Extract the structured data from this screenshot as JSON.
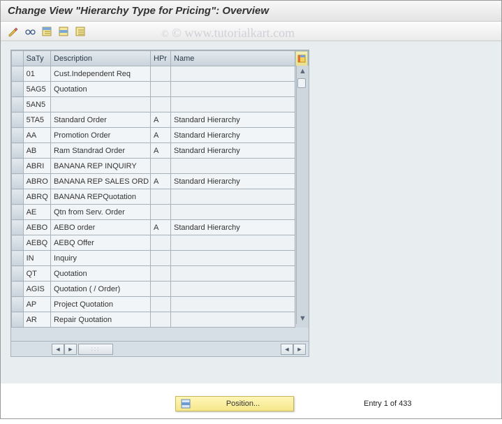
{
  "title": "Change View \"Hierarchy Type for Pricing\": Overview",
  "watermark": "© www.tutorialkart.com",
  "toolbar": {
    "icons": [
      "pencil-icon",
      "glasses-icon",
      "select-all-icon",
      "select-block-icon",
      "deselect-icon"
    ]
  },
  "table": {
    "headers": {
      "saty": "SaTy",
      "description": "Description",
      "hpr": "HPr",
      "name": "Name"
    },
    "rows": [
      {
        "saty": "01",
        "description": "Cust.Independent Req",
        "hpr": "",
        "name": ""
      },
      {
        "saty": "5AG5",
        "description": "Quotation",
        "hpr": "",
        "name": ""
      },
      {
        "saty": "5AN5",
        "description": "",
        "hpr": "",
        "name": ""
      },
      {
        "saty": "5TA5",
        "description": "Standard Order",
        "hpr": "A",
        "name": "Standard Hierarchy"
      },
      {
        "saty": "AA",
        "description": "Promotion Order",
        "hpr": "A",
        "name": "Standard Hierarchy"
      },
      {
        "saty": "AB",
        "description": "Ram Standrad Order",
        "hpr": "A",
        "name": "Standard Hierarchy"
      },
      {
        "saty": "ABRI",
        "description": "BANANA REP INQUIRY",
        "hpr": "",
        "name": ""
      },
      {
        "saty": "ABRO",
        "description": "BANANA REP SALES ORD",
        "hpr": "A",
        "name": "Standard Hierarchy"
      },
      {
        "saty": "ABRQ",
        "description": "BANANA REPQuotation",
        "hpr": "",
        "name": ""
      },
      {
        "saty": "AE",
        "description": "Qtn from Serv. Order",
        "hpr": "",
        "name": ""
      },
      {
        "saty": "AEBO",
        "description": "AEBO order",
        "hpr": "A",
        "name": "Standard Hierarchy"
      },
      {
        "saty": "AEBQ",
        "description": "AEBQ Offer",
        "hpr": "",
        "name": ""
      },
      {
        "saty": "IN",
        "description": "Inquiry",
        "hpr": "",
        "name": ""
      },
      {
        "saty": "QT",
        "description": "Quotation",
        "hpr": "",
        "name": ""
      },
      {
        "saty": "AGIS",
        "description": "Quotation ( / Order)",
        "hpr": "",
        "name": ""
      },
      {
        "saty": "AP",
        "description": "Project Quotation",
        "hpr": "",
        "name": ""
      },
      {
        "saty": "AR",
        "description": "Repair Quotation",
        "hpr": "",
        "name": ""
      }
    ]
  },
  "footer": {
    "position_label": "Position...",
    "entry_text": "Entry 1 of 433"
  }
}
